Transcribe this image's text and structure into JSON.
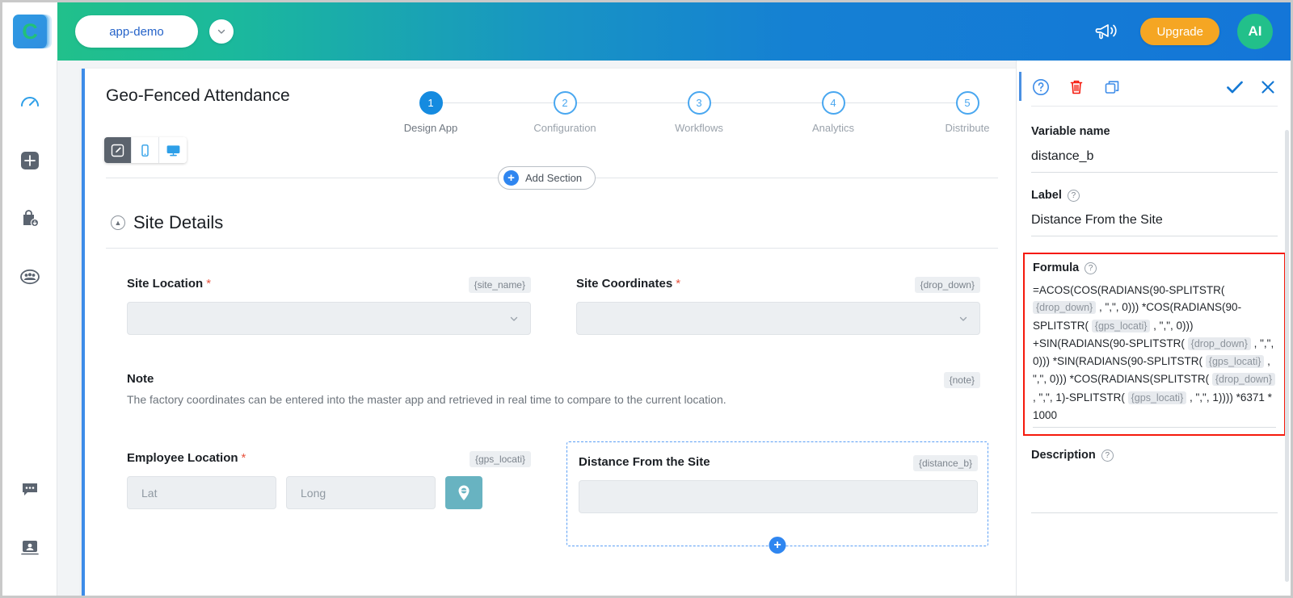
{
  "topbar": {
    "logo_letter": "C",
    "app_name": "app-demo",
    "upgrade_label": "Upgrade",
    "ai_label": "AI",
    "icons": {
      "announcement": "megaphone-icon",
      "chevron": "chevron-down-icon"
    }
  },
  "rail": {
    "items": [
      {
        "name": "dashboard-icon",
        "active": true
      },
      {
        "name": "add-icon",
        "active": false
      },
      {
        "name": "store-icon",
        "active": false
      },
      {
        "name": "users-icon",
        "active": false
      },
      {
        "name": "chat-icon",
        "active": false
      },
      {
        "name": "account-icon",
        "active": false
      }
    ]
  },
  "canvas": {
    "page_title": "Geo-Fenced Attendance",
    "view_modes": [
      {
        "name": "edit-mode",
        "selected": true
      },
      {
        "name": "mobile-preview",
        "selected": false
      },
      {
        "name": "desktop-preview",
        "selected": false
      }
    ],
    "stepper": [
      {
        "number": "1",
        "label": "Design App",
        "current": true
      },
      {
        "number": "2",
        "label": "Configuration",
        "current": false
      },
      {
        "number": "3",
        "label": "Workflows",
        "current": false
      },
      {
        "number": "4",
        "label": "Analytics",
        "current": false
      },
      {
        "number": "5",
        "label": "Distribute",
        "current": false
      }
    ],
    "add_section_label": "Add Section",
    "section_title": "Site Details",
    "fields": {
      "site_location": {
        "label": "Site Location",
        "required": "*",
        "var": "{site_name}",
        "value": ""
      },
      "site_coordinates": {
        "label": "Site Coordinates",
        "required": "*",
        "var": "{drop_down}",
        "value": ""
      },
      "note": {
        "label": "Note",
        "var": "{note}",
        "text": "The factory coordinates can be entered into the master app and retrieved in real time to compare to the current location."
      },
      "employee_location": {
        "label": "Employee Location",
        "required": "*",
        "var": "{gps_locati}",
        "lat_placeholder": "Lat",
        "long_placeholder": "Long",
        "geo_icon": "map-pin-icon"
      },
      "distance_from_site": {
        "label": "Distance From the Site",
        "var": "{distance_b}",
        "value": ""
      }
    }
  },
  "right_panel": {
    "toolbar": [
      {
        "name": "help-icon",
        "color": "#3d8ce8"
      },
      {
        "name": "delete-icon",
        "color": "#f5190c"
      },
      {
        "name": "duplicate-icon",
        "color": "#3d8ce8"
      },
      {
        "name": "confirm-check-icon",
        "color": "#1478d4"
      },
      {
        "name": "close-icon",
        "color": "#1478d4"
      }
    ],
    "variable_name_label": "Variable name",
    "variable_name_value": "distance_b",
    "label_label": "Label",
    "label_value": "Distance From the Site",
    "formula_label": "Formula",
    "formula_segments": [
      {
        "t": "text",
        "v": "=ACOS(COS(RADIANS(90-SPLITSTR( "
      },
      {
        "t": "token",
        "v": "{drop_down}"
      },
      {
        "t": "text",
        "v": " , \",\", 0))) *COS(RADIANS(90-SPLITSTR( "
      },
      {
        "t": "token",
        "v": "{gps_locati}"
      },
      {
        "t": "text",
        "v": " , \",\", 0))) +SIN(RADIANS(90-SPLITSTR( "
      },
      {
        "t": "token",
        "v": "{drop_down}"
      },
      {
        "t": "text",
        "v": " , \",\", 0))) *SIN(RADIANS(90-SPLITSTR( "
      },
      {
        "t": "token",
        "v": "{gps_locati}"
      },
      {
        "t": "text",
        "v": " , \",\", 0))) *COS(RADIANS(SPLITSTR( "
      },
      {
        "t": "token",
        "v": "{drop_down}"
      },
      {
        "t": "text",
        "v": " , \",\", 1)-SPLITSTR( "
      },
      {
        "t": "token",
        "v": "{gps_locati}"
      },
      {
        "t": "text",
        "v": " , \",\", 1)))) *6371 * 1000"
      }
    ],
    "formula_plain": "=ACOS(COS(RADIANS(90-SPLITSTR( {drop_down} , \",\", 0))) *COS(RADIANS(90-SPLITSTR( {gps_locati} , \",\", 0))) +SIN(RADIANS(90-SPLITSTR( {drop_down} , \",\", 0))) *SIN(RADIANS(90-SPLITSTR( {gps_locati} , \",\", 0))) *COS(RADIANS(SPLITSTR( {drop_down} , \",\", 1)-SPLITSTR( {gps_locati} , \",\", 1)))) *6371 * 1000",
    "description_label": "Description",
    "description_value": ""
  },
  "colors": {
    "header_gradient_start": "#21c08b",
    "header_gradient_end": "#1476d8",
    "accent_blue": "#2f86f0",
    "upgrade_orange": "#f5a623",
    "ai_green": "#22c08a",
    "highlight_red": "#f5190c",
    "geo_teal": "#68b3c1"
  }
}
